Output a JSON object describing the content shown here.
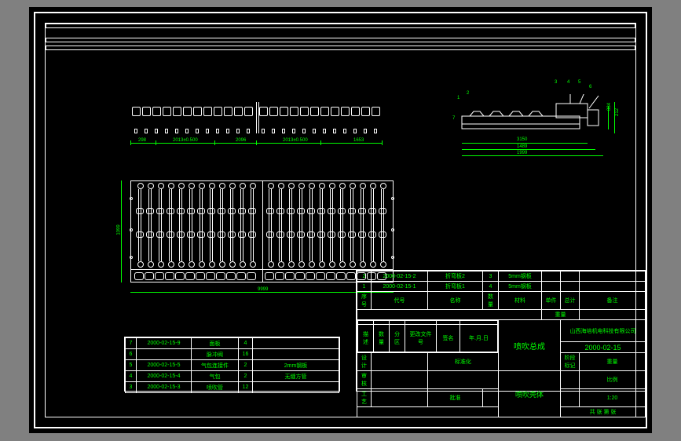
{
  "elevation_dims": {
    "d1": "298",
    "d2": "2013±0.500",
    "d3": "2096",
    "d4": "2013±0.500",
    "d5": "1653"
  },
  "assy": {
    "callouts": [
      "1",
      "2",
      "3",
      "4",
      "5",
      "6",
      "7"
    ],
    "dims": [
      "3150",
      "1489",
      "1999",
      "884",
      "212"
    ]
  },
  "plan_dims": {
    "height": "1099",
    "width": "9999"
  },
  "bom_upper": {
    "rows": [
      {
        "no": "2",
        "code": "2000-02-15-2",
        "name": "折弯板2",
        "qty": "3",
        "mat": "5mm钢板"
      },
      {
        "no": "1",
        "code": "2000-02-15-1",
        "name": "折弯板1",
        "qty": "4",
        "mat": "5mm钢板"
      }
    ],
    "headers": {
      "no": "序号",
      "code": "代号",
      "name": "名称",
      "qty": "数量",
      "mat": "材料",
      "single": "单件",
      "total": "总计",
      "remark": "备注",
      "zl": "重量"
    }
  },
  "bom_left": {
    "rows": [
      {
        "no": "7",
        "code": "2000-02-15-9",
        "name": "面板",
        "qty": "4",
        "mat": ""
      },
      {
        "no": "6",
        "code": "",
        "name": "脉冲阀",
        "qty": "16",
        "mat": ""
      },
      {
        "no": "5",
        "code": "2000-02-15-5",
        "name": "气包连接件",
        "qty": "2",
        "mat": "2mm钢板"
      },
      {
        "no": "4",
        "code": "2000-02-15-4",
        "name": "气包",
        "qty": "2",
        "mat": "无缝方管"
      },
      {
        "no": "3",
        "code": "2000-02-15-3",
        "name": "喷吹管",
        "qty": "12",
        "mat": ""
      }
    ]
  },
  "title_block": {
    "approve_row": [
      "描述",
      "数量",
      "分区",
      "更改文件号",
      "签名",
      "年.月.日"
    ],
    "roles": [
      "设计",
      "审核",
      "工艺",
      "标准化",
      "",
      "批准"
    ],
    "stage": "阶段标记",
    "mass": "重量",
    "scale": "比例",
    "scale_val": "1:20",
    "main_title": "喷吹总成",
    "sub_title": "喷吹壳体",
    "company": "山西海培机电科技有限公司",
    "dwg_no": "2000-02-15",
    "sheets": "共  张  第  张"
  }
}
